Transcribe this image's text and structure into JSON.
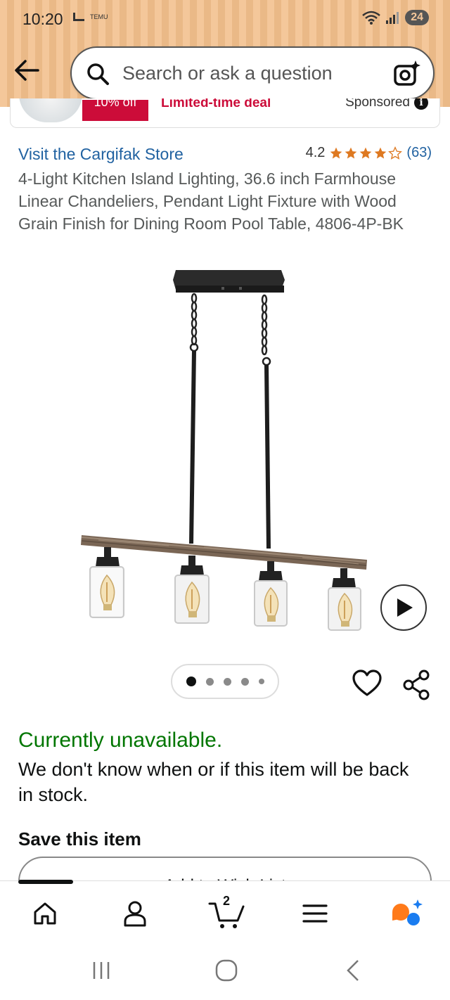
{
  "status_bar": {
    "time": "10:20",
    "mini_label": "TEMU",
    "battery": "24"
  },
  "header": {
    "search_placeholder": "Search or ask a question",
    "icons": [
      "back-arrow-icon",
      "search-icon",
      "camera-icon"
    ]
  },
  "ad": {
    "badge": "10% off",
    "deal": "Limited-time deal",
    "sponsored": "Sponsored"
  },
  "product": {
    "store_link": "Visit the Cargifak Store",
    "rating_value": "4.2",
    "rating_stars": 4.2,
    "rating_count": "(63)",
    "title": "4-Light Kitchen Island Lighting, 36.6 inch Farmhouse Linear Chandeliers, Pendant Light Fixture with Wood Grain Finish for Dining Room Pool Table, 4806-4P-BK",
    "image_count": 5,
    "current_image": 1
  },
  "availability": {
    "status": "Currently unavailable.",
    "message": "We don't know when or if this item will be back in stock."
  },
  "save": {
    "heading": "Save this item",
    "wish_list_button": "Add to Wish List"
  },
  "bottom_nav": {
    "cart_count": "2",
    "items": [
      "home-icon",
      "account-icon",
      "cart-icon",
      "menu-icon",
      "rufus-icon"
    ]
  },
  "colors": {
    "link": "#2162a1",
    "available_green": "#007600",
    "star": "#de7921",
    "deal_red": "#cc0c39",
    "header_bg": "#f4c79a"
  }
}
